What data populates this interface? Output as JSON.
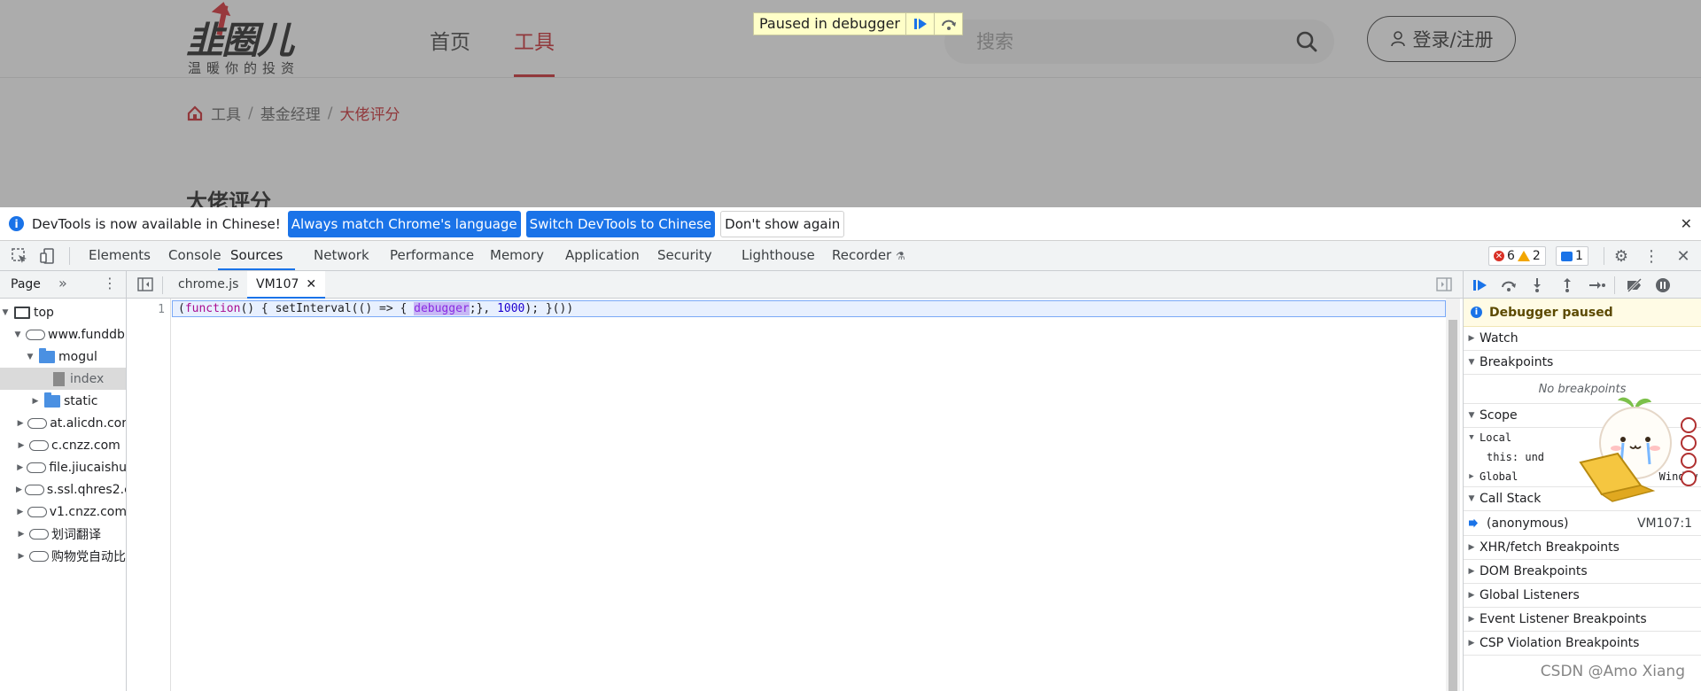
{
  "page": {
    "logo_text": "韭圈儿",
    "logo_slogan": "温暖你的投资",
    "nav": [
      {
        "label": "首页"
      },
      {
        "label": "工具"
      }
    ],
    "search": {
      "placeholder": "搜索"
    },
    "login_label": "登录/注册",
    "breadcrumb": [
      "工具",
      "基金经理",
      "大佬评分"
    ],
    "title": "大佬评分",
    "paused_label": "Paused in debugger"
  },
  "devtools": {
    "infobar": {
      "message": "DevTools is now available in Chinese!",
      "btn_match": "Always match Chrome's language",
      "btn_switch": "Switch DevTools to Chinese",
      "btn_dismiss": "Don't show again"
    },
    "tabs": [
      "Elements",
      "Console",
      "Sources",
      "Network",
      "Performance",
      "Memory",
      "Application",
      "Security",
      "Lighthouse",
      "Recorder"
    ],
    "counts": {
      "errors": "6",
      "warnings": "2",
      "messages": "1"
    },
    "navigator": {
      "tab": "Page",
      "tree": [
        {
          "label": "top"
        },
        {
          "label": "www.funddb"
        },
        {
          "label": "mogul"
        },
        {
          "label": "index"
        },
        {
          "label": "static"
        },
        {
          "label": "at.alicdn.cor"
        },
        {
          "label": "c.cnzz.com"
        },
        {
          "label": "file.jiucaishu"
        },
        {
          "label": "s.ssl.qhres2.c"
        },
        {
          "label": "v1.cnzz.com"
        },
        {
          "label": "划词翻译"
        },
        {
          "label": "购物党自动比"
        }
      ]
    },
    "editor": {
      "tabs": [
        "chrome.js",
        "VM107"
      ],
      "line_number": "1",
      "code": {
        "p1": "(",
        "kw": "function",
        "p2": "() { setInterval(() => { ",
        "debugger": "debugger",
        "p3": ";}, ",
        "num": "1000",
        "p4": "); }())"
      }
    },
    "sidebar": {
      "paused": "Debugger paused",
      "watch": "Watch",
      "breakpoints": "Breakpoints",
      "no_breakpoints": "No breakpoints",
      "scope": "Scope",
      "local": "Local",
      "this_row": "this: und",
      "global": "Global",
      "global_value": "Window",
      "call_stack": "Call Stack",
      "frame_name": "(anonymous)",
      "frame_loc": "VM107:1",
      "panes": [
        "XHR/fetch Breakpoints",
        "DOM Breakpoints",
        "Global Listeners",
        "Event Listener Breakpoints",
        "CSP Violation Breakpoints"
      ]
    }
  },
  "watermark": "CSDN @Amo Xiang",
  "colors": {
    "accent_red": "#c8161d",
    "devtools_blue": "#1a73e8"
  }
}
